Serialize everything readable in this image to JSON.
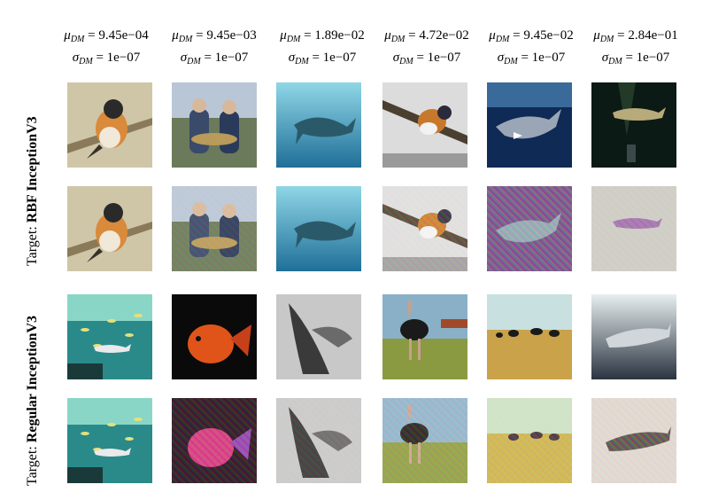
{
  "columns": [
    {
      "mu": "9.45e−04",
      "sigma": "1e−07"
    },
    {
      "mu": "9.45e−03",
      "sigma": "1e−07"
    },
    {
      "mu": "1.89e−02",
      "sigma": "1e−07"
    },
    {
      "mu": "4.72e−02",
      "sigma": "1e−07"
    },
    {
      "mu": "9.45e−02",
      "sigma": "1e−07"
    },
    {
      "mu": "2.84e−01",
      "sigma": "1e−07"
    }
  ],
  "header_symbols": {
    "mu": "μ",
    "sigma": "σ",
    "subscript": "DM",
    "equals": " = "
  },
  "row_groups": [
    {
      "prefix": "Target: ",
      "model": "RBF InceptionV3"
    },
    {
      "prefix": "Target: ",
      "model": "Regular InceptionV3"
    }
  ],
  "colors": {
    "sky": "#bfe3ef",
    "ocean": "#1f7fa8",
    "deep_ocean": "#0f2a55",
    "dark": "#0b1a14",
    "sand": "#c9a24a",
    "grass": "#8a9a40"
  }
}
